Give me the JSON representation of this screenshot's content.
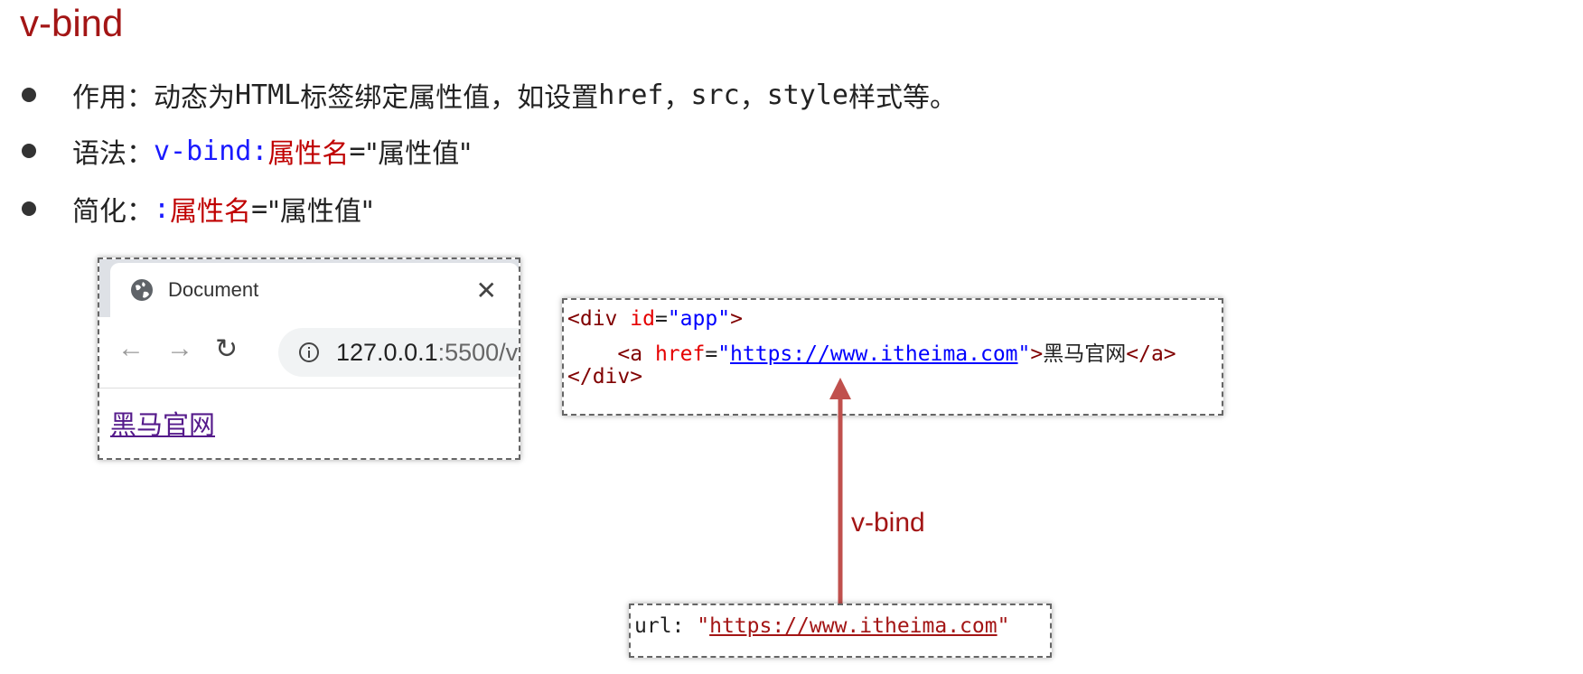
{
  "title": "v-bind",
  "bullets": [
    {
      "prefix": "作用：动态为",
      "code1": "HTML",
      "mid": "标签绑定属性值，如设置",
      "code2": "href",
      "sep1": "，",
      "code3": "src",
      "sep2": "，",
      "code4": "style",
      "suffix": "样式等。"
    },
    {
      "prefix": "语法：",
      "directive": "v-bind:",
      "attr_name": "属性名",
      "eq": "=",
      "value": "\"属性值\""
    },
    {
      "prefix": "简化：",
      "directive": ":",
      "attr_name": "属性名",
      "eq": "=",
      "value": "\"属性值\""
    }
  ],
  "browser": {
    "tab_title": "Document",
    "close_glyph": "✕",
    "back_glyph": "←",
    "forward_glyph": "→",
    "reload_glyph": "↻",
    "url_host": "127.0.0.1",
    "url_rest": ":5500/v",
    "link_text": "黑马官网",
    "icons": [
      "globe-icon",
      "close-icon",
      "back-arrow-icon",
      "forward-arrow-icon",
      "reload-icon",
      "info-icon"
    ]
  },
  "code_snippet": {
    "line1": {
      "open": "<div ",
      "attr": "id",
      "eq": "=",
      "val": "\"app\"",
      "close": ">"
    },
    "line2": {
      "indent": "    ",
      "open": "<a ",
      "attr": "href",
      "eq": "=",
      "q1": "\"",
      "url": "https://www.itheima.com",
      "q2": "\"",
      "gt": ">",
      "text": "黑马官网",
      "end": "</a>"
    },
    "line3": {
      "close": "</div>"
    }
  },
  "data_snippet": {
    "key": "url: ",
    "q1": "\"",
    "url": "https://www.itheima.com",
    "q2": "\""
  },
  "arrow_label": "v-bind",
  "colors": {
    "title": "#a31515",
    "directive": "#1a1aff",
    "attr_name": "#c00000",
    "arrow": "#c0504d",
    "panel_border": "#666666"
  }
}
